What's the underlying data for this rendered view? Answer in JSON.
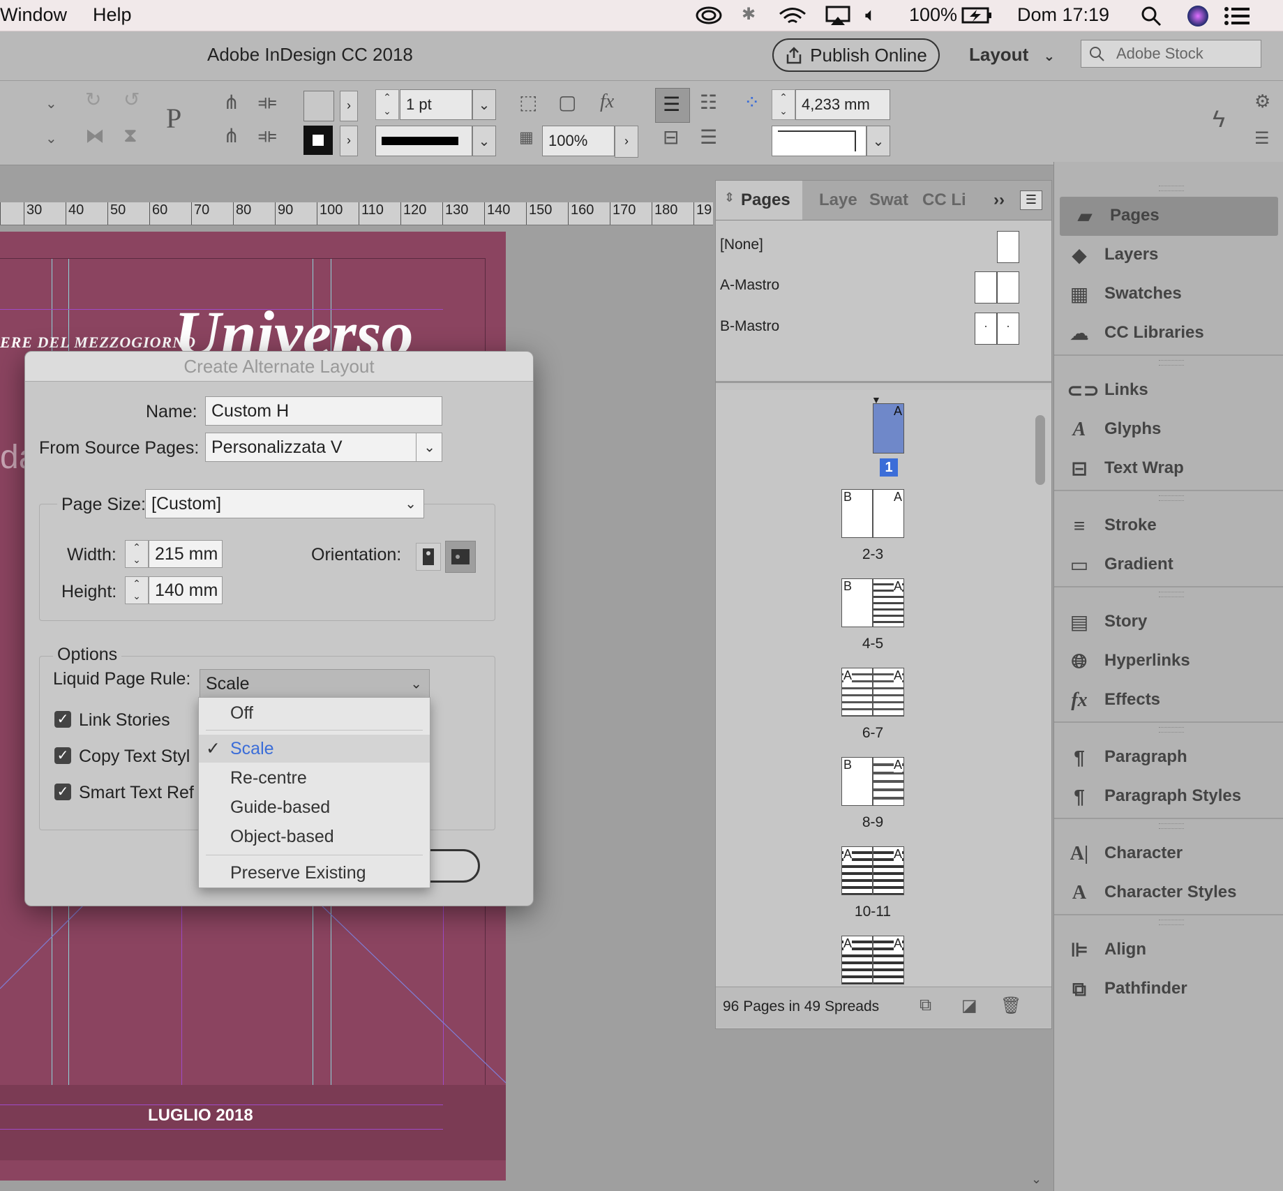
{
  "menubar": {
    "items": [
      "Window",
      "Help"
    ],
    "battery": "100%",
    "clock": "Dom 17:19",
    "icons": [
      "creative-cloud-icon",
      "bluetooth-icon",
      "wifi-icon",
      "airplay-icon",
      "volume-icon",
      "battery-icon",
      "spotlight-icon",
      "siri-icon",
      "notification-center-icon"
    ]
  },
  "titlebar": {
    "app_title": "Adobe InDesign CC 2018",
    "publish_online": "Publish Online",
    "workspace": "Layout",
    "stock_placeholder": "Adobe Stock"
  },
  "controlbar": {
    "stroke_weight": "1 pt",
    "opacity": "100%",
    "spacing": "4,233 mm"
  },
  "ruler": {
    "ticks": [
      "30",
      "40",
      "50",
      "60",
      "70",
      "80",
      "90",
      "100",
      "110",
      "120",
      "130",
      "140",
      "150",
      "160",
      "170",
      "180",
      "19"
    ]
  },
  "document": {
    "masthead": "Universo",
    "masthead_prefix": "ERE DEL MEZZOGIORNO",
    "side_fragment": "da",
    "footer_date": "LUGLIO 2018"
  },
  "dialog": {
    "title": "Create Alternate Layout",
    "name_label": "Name:",
    "name_value": "Custom H",
    "source_label": "From Source Pages:",
    "source_value": "Personalizzata V",
    "page_size_label": "Page Size:",
    "page_size_value": "[Custom]",
    "width_label": "Width:",
    "width_value": "215 mm",
    "height_label": "Height:",
    "height_value": "140 mm",
    "orientation_label": "Orientation:",
    "options_label": "Options",
    "liquid_label": "Liquid Page Rule:",
    "liquid_value": "Scale",
    "check_link_stories": "Link Stories",
    "check_copy_text_styles": "Copy Text Styl",
    "check_smart_text_reflow": "Smart Text Ref",
    "menu": {
      "off": "Off",
      "scale": "Scale",
      "recentre": "Re-centre",
      "guide": "Guide-based",
      "object": "Object-based",
      "preserve": "Preserve Existing"
    }
  },
  "pages_panel": {
    "tabs": [
      "Pages",
      "Laye",
      "Swat",
      "CC Li"
    ],
    "masters": [
      "[None]",
      "A-Mastro",
      "B-Mastro"
    ],
    "spreads": [
      "1",
      "2-3",
      "4-5",
      "6-7",
      "8-9",
      "10-11"
    ],
    "footer": "96 Pages in 49 Spreads"
  },
  "dock": {
    "items": [
      "Pages",
      "Layers",
      "Swatches",
      "CC Libraries",
      "Links",
      "Glyphs",
      "Text Wrap",
      "Stroke",
      "Gradient",
      "Story",
      "Hyperlinks",
      "Effects",
      "Paragraph",
      "Paragraph Styles",
      "Character",
      "Character Styles",
      "Align",
      "Pathfinder"
    ]
  },
  "colors": {
    "doc_background": "#8b4460",
    "selection_blue": "#3b6dd8"
  }
}
